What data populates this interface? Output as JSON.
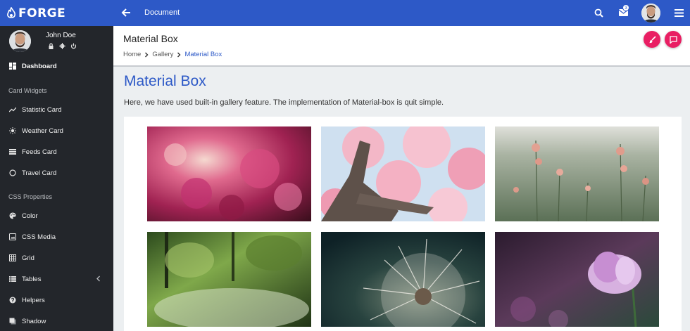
{
  "brand": {
    "name": "FORGE"
  },
  "topbar": {
    "title": "Document",
    "mail_count": "3"
  },
  "user": {
    "name": "John Doe"
  },
  "sidebar": {
    "dashboard": "Dashboard",
    "section_cards": "Card Widgets",
    "statistic": "Statistic Card",
    "weather": "Weather Card",
    "feeds": "Feeds Card",
    "travel": "Travel Card",
    "section_css": "CSS Properties",
    "color": "Color",
    "media": "CSS Media",
    "grid": "Grid",
    "tables": "Tables",
    "helpers": "Helpers",
    "shadow": "Shadow"
  },
  "header": {
    "title": "Material Box",
    "crumb_home": "Home",
    "crumb_gallery": "Gallery",
    "crumb_current": "Material Box"
  },
  "page": {
    "title": "Material Box",
    "description": "Here, we have used built-in gallery feature. The implementation of Material-box is quit simple."
  },
  "colors": {
    "primary": "#2d59c7",
    "accent": "#e91e63",
    "sidebar": "#23262b"
  }
}
